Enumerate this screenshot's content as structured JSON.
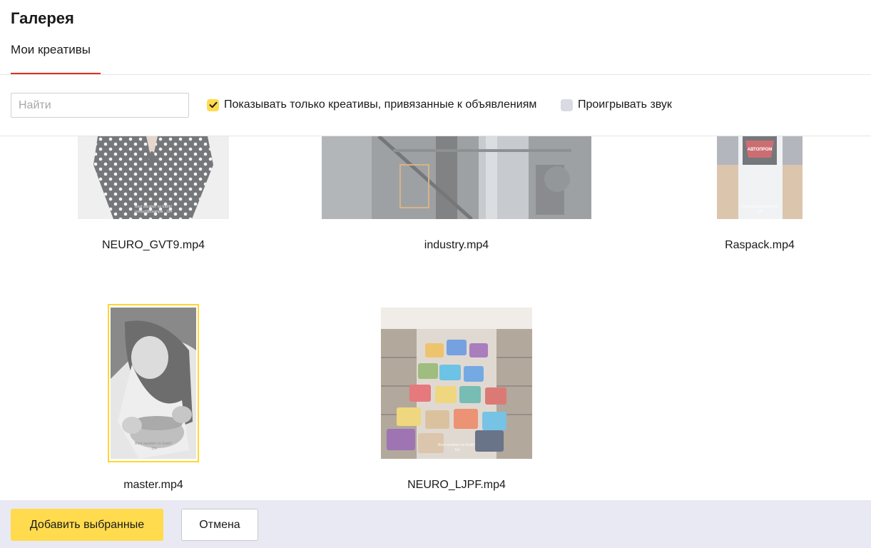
{
  "header": {
    "title": "Галерея"
  },
  "tabs": [
    {
      "label": "Мои креативы",
      "active": true
    }
  ],
  "toolbar": {
    "search_placeholder": "Найти",
    "search_value": "",
    "filter_linked": {
      "label": "Показывать только креативы, привязанные к объявлениям",
      "checked": true
    },
    "play_sound": {
      "label": "Проигрывать звук",
      "checked": false
    }
  },
  "gallery": {
    "items": [
      {
        "file": "NEURO_GVT9.mp4",
        "selected": false
      },
      {
        "file": "industry.mp4",
        "selected": false
      },
      {
        "file": "Raspack.mp4",
        "selected": false
      },
      {
        "file": "master.mp4",
        "selected": true
      },
      {
        "file": "NEURO_LJPF.mp4",
        "selected": false
      }
    ],
    "thumb_labels": {
      "raspack_brand": "АВТОПРОМ"
    }
  },
  "footer": {
    "add_label": "Добавить выбранные",
    "cancel_label": "Отмена"
  },
  "colors": {
    "accent": "#ffdb4d",
    "tab_underline": "#e0301e",
    "selection": "#ffd633",
    "footer_bg": "#e8e9f2"
  }
}
